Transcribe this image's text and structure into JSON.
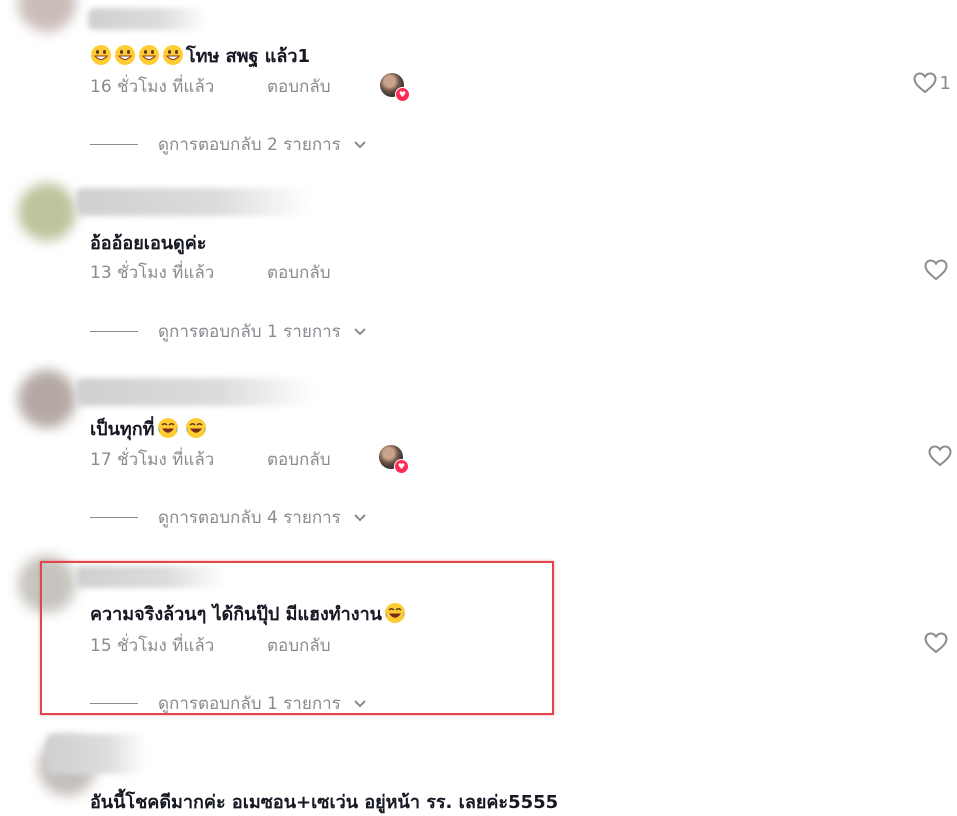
{
  "comments": [
    {
      "text": "โทษ สพฐ แล้ว1",
      "emoji_prefix": [
        "grinning-face-icon",
        "grinning-face-icon",
        "grinning-face-icon",
        "grinning-face-icon"
      ],
      "time": "16 ชั่วโมง ที่แล้ว",
      "reply": "ตอบกลับ",
      "creator_liked": true,
      "like_count": "1",
      "view_replies": "ดูการตอบกลับ 2 รายการ"
    },
    {
      "text": "อ้ออ้อยเอนดูค่ะ",
      "time": "13 ชั่วโมง ที่แล้ว",
      "reply": "ตอบกลับ",
      "creator_liked": false,
      "like_count": "",
      "view_replies": "ดูการตอบกลับ 1 รายการ"
    },
    {
      "text": "เป็นทุกที่",
      "emoji_suffix": [
        "laughing-face-icon",
        "laughing-face-icon"
      ],
      "time": "17 ชั่วโมง ที่แล้ว",
      "reply": "ตอบกลับ",
      "creator_liked": true,
      "like_count": "",
      "view_replies": "ดูการตอบกลับ 4 รายการ"
    },
    {
      "text": "ความจริงล้วนๆ ได้กินปุ๊ป มีแฮงทำงาน",
      "emoji_suffix": [
        "laughing-face-icon"
      ],
      "time": "15 ชั่วโมง ที่แล้ว",
      "reply": "ตอบกลับ",
      "creator_liked": false,
      "like_count": "",
      "view_replies": "ดูการตอบกลับ 1 รายการ",
      "highlighted": true
    },
    {
      "text": "อันนี้โชคดีมากค่ะ อเมซอน+เซเว่น อยู่หน้า รร. เลยค่ะ5555"
    }
  ],
  "colors": {
    "text": "#161823",
    "secondary": "#8a8b91",
    "like_badge": "#fe2c55",
    "highlight_border": "#e0474c"
  }
}
